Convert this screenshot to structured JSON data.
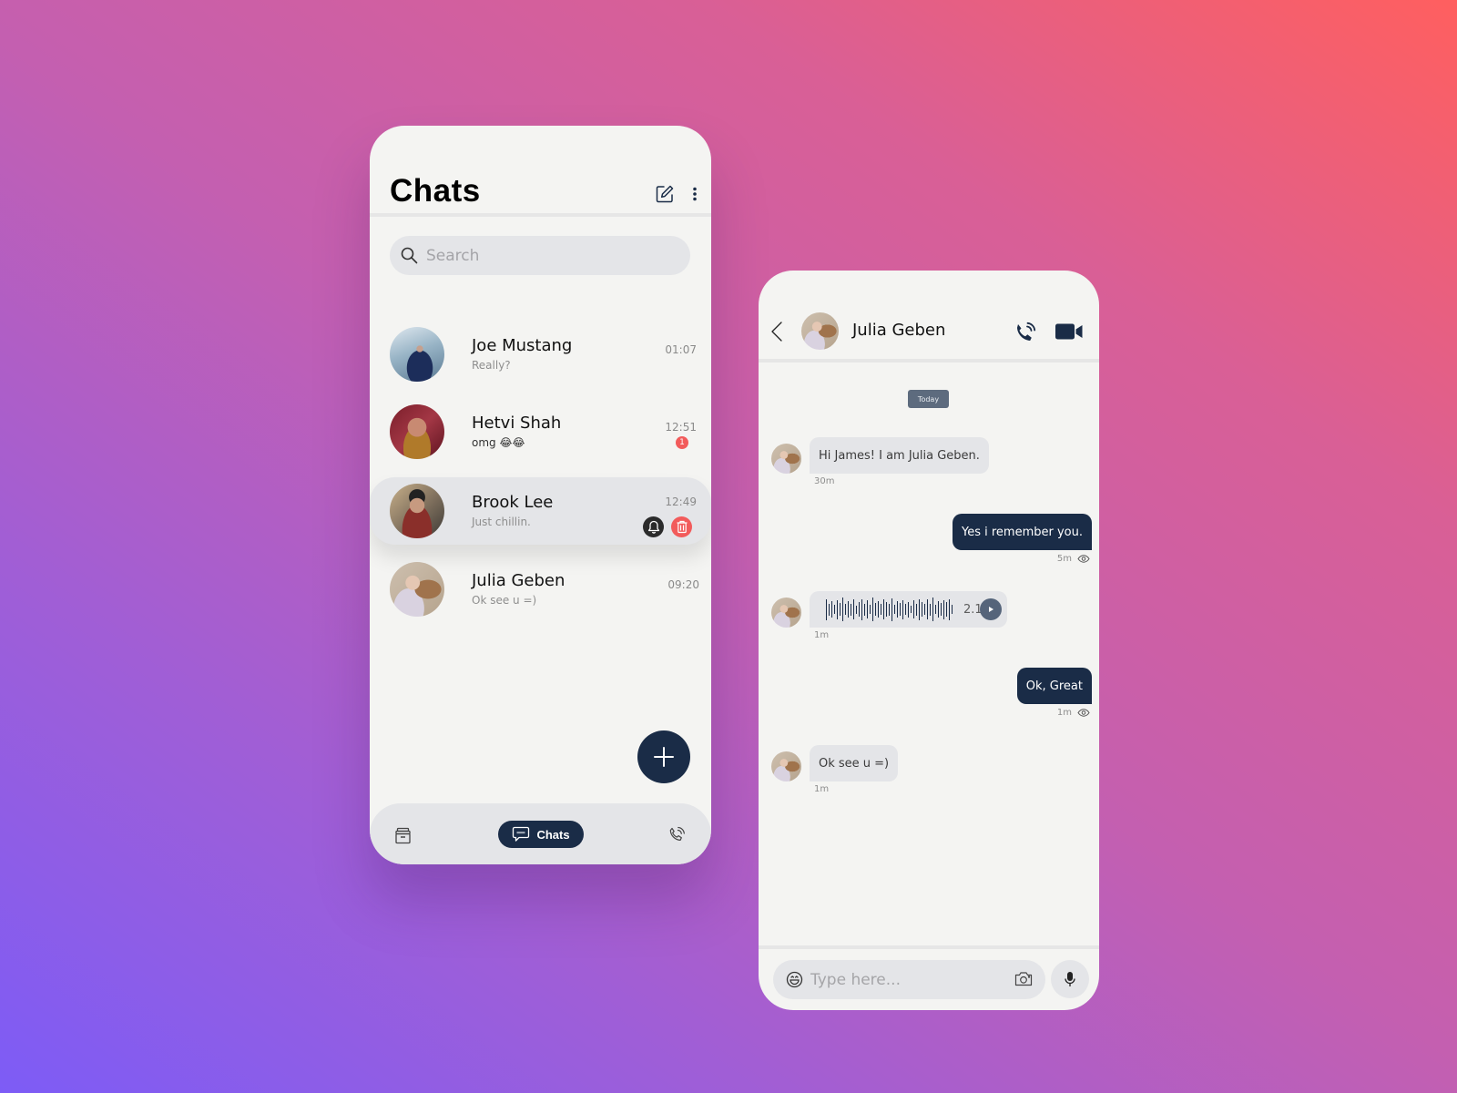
{
  "chat_list": {
    "title": "Chats",
    "header_icons": [
      "edit-icon",
      "more-vertical-icon"
    ],
    "search": {
      "placeholder": "Search",
      "value": ""
    },
    "conversations": [
      {
        "name": "Joe Mustang",
        "preview": "Really?",
        "time": "01:07",
        "unread": null,
        "selected": false
      },
      {
        "name": "Hetvi Shah",
        "preview": "omg 😂😂",
        "time": "12:51",
        "unread": "1",
        "selected": false
      },
      {
        "name": "Brook Lee",
        "preview": "Just chillin.",
        "time": "12:49",
        "unread": null,
        "selected": true,
        "actions": [
          "bell-icon",
          "trash-icon"
        ]
      },
      {
        "name": "Julia Geben",
        "preview": "Ok see u =)",
        "time": "09:20",
        "unread": null,
        "selected": false
      }
    ],
    "fab_icon": "plus-icon",
    "bottom_nav": {
      "items": [
        {
          "icon": "archive-icon",
          "label": ""
        },
        {
          "icon": "chat-bubble-icon",
          "label": "Chats",
          "active": true
        },
        {
          "icon": "phone-call-icon",
          "label": ""
        }
      ]
    }
  },
  "conversation": {
    "contact_name": "Julia Geben",
    "header_icons": [
      "back-chevron-icon",
      "phone-call-icon",
      "video-camera-icon"
    ],
    "date_separator": "Today",
    "messages": [
      {
        "direction": "in",
        "type": "text",
        "text": "Hi James! I am Julia Geben.",
        "time": "30m"
      },
      {
        "direction": "out",
        "type": "text",
        "text": "Yes i remember you.",
        "time": "5m",
        "seen": true
      },
      {
        "direction": "in",
        "type": "voice",
        "duration": "2.18",
        "time": "1m"
      },
      {
        "direction": "out",
        "type": "text",
        "text": "Ok, Great",
        "time": "1m",
        "seen": true
      },
      {
        "direction": "in",
        "type": "text",
        "text": "Ok see u =)",
        "time": "1m"
      }
    ],
    "composer": {
      "placeholder": "Type here...",
      "value": ""
    }
  },
  "colors": {
    "accent_navy": "#1a2c47",
    "unread_red": "#f25b5b",
    "surface": "#f4f4f2",
    "input_gray": "#e4e5e8",
    "badge_slate": "#5d6b7e"
  }
}
